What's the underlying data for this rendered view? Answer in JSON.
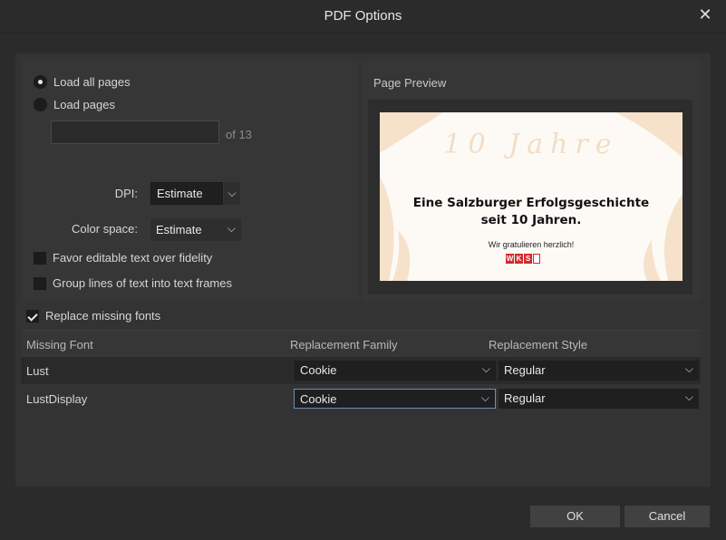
{
  "dialog": {
    "title": "PDF Options",
    "close_icon": "close-icon"
  },
  "pages": {
    "load_all_label": "Load all pages",
    "load_all_selected": true,
    "load_pages_label": "Load pages",
    "pages_value": "",
    "of_label": "of 13"
  },
  "dpi": {
    "label": "DPI:",
    "value": "Estimate"
  },
  "color_space": {
    "label": "Color space:",
    "value": "Estimate"
  },
  "favor_editable": {
    "label": "Favor editable text over fidelity",
    "checked": false
  },
  "group_lines": {
    "label": "Group lines of text into text frames",
    "checked": false
  },
  "preview": {
    "label": "Page Preview",
    "script_text": "10 Jahre",
    "headline_1": "Eine Salzburger Erfolgsgeschichte",
    "headline_2": "seit 10 Jahren.",
    "subtext": "Wir gratulieren herzlich!",
    "logo_letters": [
      "W",
      "K",
      "S"
    ]
  },
  "replace_missing": {
    "label": "Replace missing fonts",
    "checked": true
  },
  "fonts_table": {
    "columns": [
      "Missing Font",
      "Replacement Family",
      "Replacement Style"
    ],
    "rows": [
      {
        "missing": "Lust",
        "family": "Cookie",
        "style": "Regular"
      },
      {
        "missing": "LustDisplay",
        "family": "Cookie",
        "style": "Regular"
      }
    ]
  },
  "buttons": {
    "ok": "OK",
    "cancel": "Cancel"
  },
  "colors": {
    "accent": "#6d8fb8",
    "logo_red": "#d42b2b"
  }
}
